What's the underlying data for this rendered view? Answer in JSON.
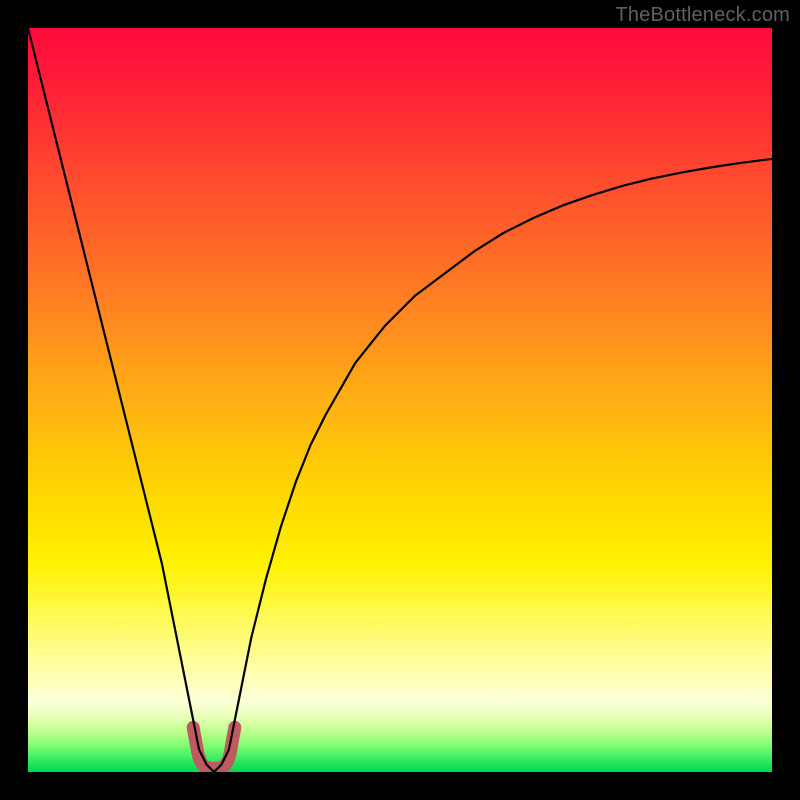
{
  "watermark": "TheBottleneck.com",
  "chart_data": {
    "type": "line",
    "title": "",
    "xlabel": "",
    "ylabel": "",
    "xlim": [
      0,
      100
    ],
    "ylim": [
      0,
      100
    ],
    "x": [
      0,
      2,
      4,
      6,
      8,
      10,
      12,
      14,
      16,
      18,
      20,
      22,
      23,
      24,
      25,
      26,
      27,
      28,
      30,
      32,
      34,
      36,
      38,
      40,
      44,
      48,
      52,
      56,
      60,
      64,
      68,
      72,
      76,
      80,
      84,
      88,
      92,
      96,
      100
    ],
    "y": [
      100,
      92,
      84,
      76,
      68,
      60,
      52,
      44,
      36,
      28,
      18,
      8,
      3,
      1,
      0,
      1,
      3,
      8,
      18,
      26,
      33,
      39,
      44,
      48,
      55,
      60,
      64,
      67,
      70,
      72.5,
      74.5,
      76.2,
      77.6,
      78.8,
      79.8,
      80.6,
      81.3,
      81.9,
      82.4
    ],
    "series": [
      {
        "name": "bottleneck-curve",
        "color": "#000000"
      }
    ],
    "gradient_stops": [
      {
        "offset": 0.0,
        "color": "#ff0a3a"
      },
      {
        "offset": 0.08,
        "color": "#ff1f37"
      },
      {
        "offset": 0.2,
        "color": "#ff4a2e"
      },
      {
        "offset": 0.35,
        "color": "#ff7a24"
      },
      {
        "offset": 0.5,
        "color": "#ffb014"
      },
      {
        "offset": 0.62,
        "color": "#ffd500"
      },
      {
        "offset": 0.72,
        "color": "#fff200"
      },
      {
        "offset": 0.8,
        "color": "#fffb60"
      },
      {
        "offset": 0.86,
        "color": "#ffffa8"
      },
      {
        "offset": 0.905,
        "color": "#fdffd8"
      },
      {
        "offset": 0.925,
        "color": "#e8ffb8"
      },
      {
        "offset": 0.945,
        "color": "#c0ff90"
      },
      {
        "offset": 0.965,
        "color": "#7dff70"
      },
      {
        "offset": 0.985,
        "color": "#30e860"
      },
      {
        "offset": 1.0,
        "color": "#00d850"
      }
    ],
    "marker": {
      "color": "#c05a62",
      "x_range": [
        22.2,
        27.8
      ],
      "y_range": [
        0,
        6
      ]
    }
  }
}
